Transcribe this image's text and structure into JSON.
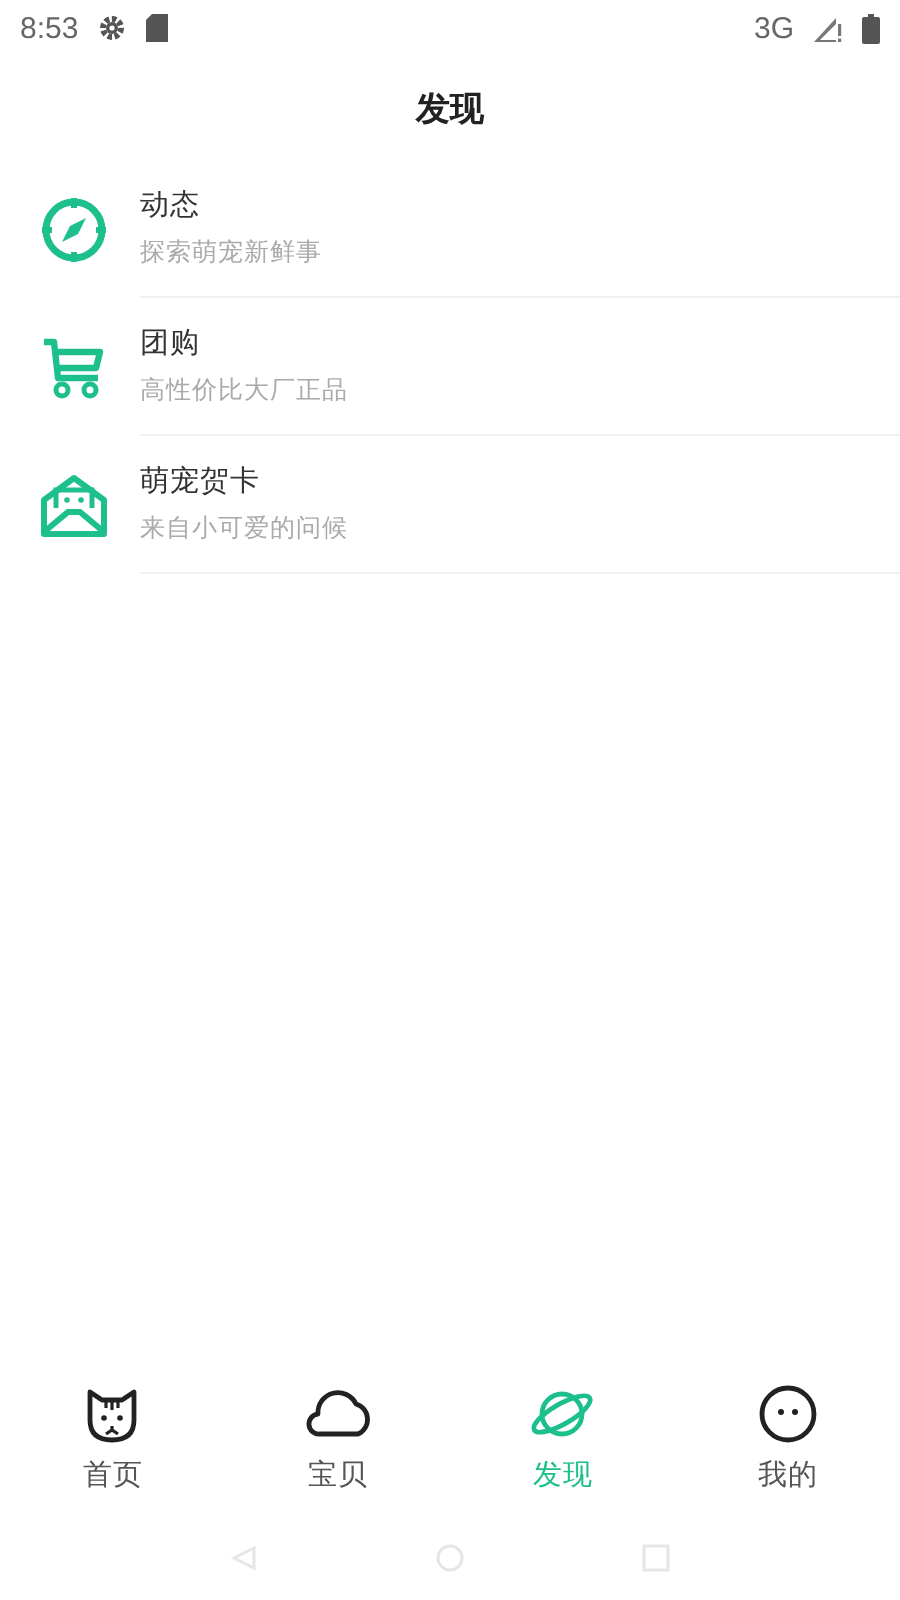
{
  "status_bar": {
    "time": "8:53",
    "network": "3G"
  },
  "header": {
    "title": "发现"
  },
  "items": [
    {
      "title": "动态",
      "subtitle": "探索萌宠新鲜事"
    },
    {
      "title": "团购",
      "subtitle": "高性价比大厂正品"
    },
    {
      "title": "萌宠贺卡",
      "subtitle": "来自小可爱的问候"
    }
  ],
  "tabs": [
    {
      "label": "首页",
      "selected": false
    },
    {
      "label": "宝贝",
      "selected": false
    },
    {
      "label": "发现",
      "selected": true
    },
    {
      "label": "我的",
      "selected": false
    }
  ]
}
